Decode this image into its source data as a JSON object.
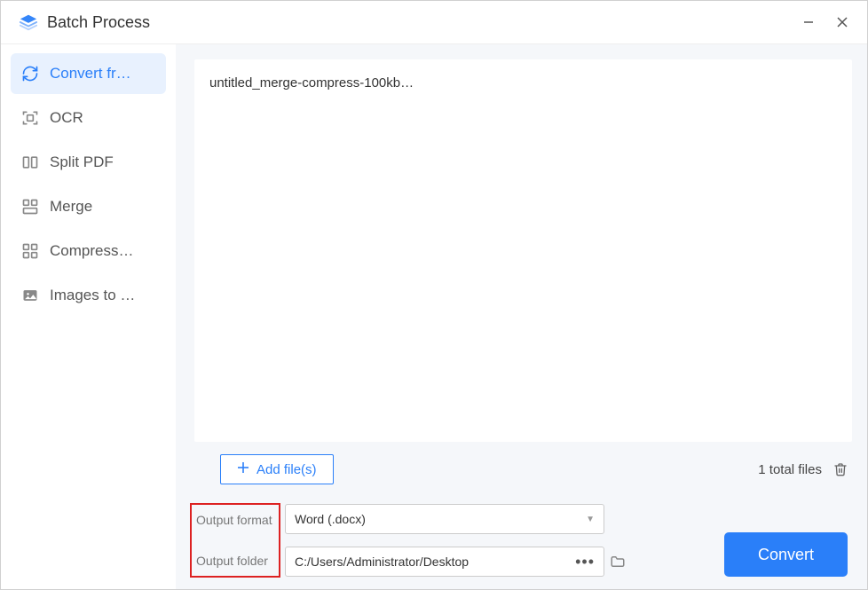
{
  "window": {
    "title": "Batch Process"
  },
  "sidebar": {
    "items": [
      {
        "label": "Convert fr…"
      },
      {
        "label": "OCR"
      },
      {
        "label": "Split PDF"
      },
      {
        "label": "Merge"
      },
      {
        "label": "Compress…"
      },
      {
        "label": "Images to …"
      }
    ]
  },
  "files": {
    "list": [
      {
        "name": "untitled_merge-compress-100kb…"
      }
    ],
    "add_label": "Add file(s)",
    "count_label": "1 total files"
  },
  "output": {
    "format_label": "Output format",
    "format_value": "Word (.docx)",
    "folder_label": "Output folder",
    "folder_value": "C:/Users/Administrator/Desktop"
  },
  "actions": {
    "convert_label": "Convert"
  }
}
